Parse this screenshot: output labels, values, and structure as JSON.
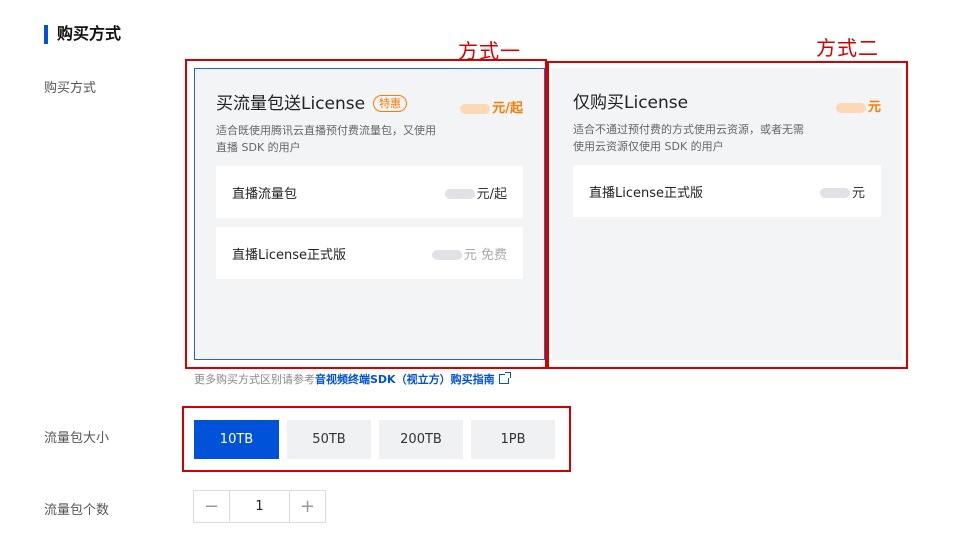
{
  "section": {
    "title": "购买方式"
  },
  "annotations": {
    "method_one": "方式一",
    "method_two": "方式二"
  },
  "purchase_method": {
    "label": "购买方式",
    "options": [
      {
        "title": "买流量包送License",
        "badge": "特惠",
        "price_suffix": "元/起",
        "description": [
          "适合既使用腾讯云直播预付费流量包，又使用",
          "直播 SDK 的用户"
        ],
        "items": [
          {
            "label": "直播流量包",
            "price_suffix": "元/起"
          },
          {
            "label": "直播License正式版",
            "price_suffix": "元 免费"
          }
        ],
        "selected": true
      },
      {
        "title": "仅购买License",
        "price_suffix": "元",
        "description": [
          "适合不通过预付费的方式使用云资源，或者无需",
          "使用云资源仅使用 SDK 的用户"
        ],
        "items": [
          {
            "label": "直播License正式版",
            "price_suffix": "元"
          }
        ],
        "selected": false
      }
    ],
    "hint_prefix": "更多购买方式区别请参考",
    "hint_link": "音视频终端SDK（视立方）购买指南"
  },
  "package_size": {
    "label": "流量包大小",
    "options": [
      "10TB",
      "50TB",
      "200TB",
      "1PB"
    ],
    "selected": "10TB"
  },
  "package_count": {
    "label": "流量包个数",
    "value": "1",
    "minus": "−",
    "plus": "+"
  },
  "colors": {
    "accent": "#0052d9",
    "price": "#ff7a00",
    "annotation": "#d40000"
  },
  "icons": {
    "link": "external-link-icon"
  }
}
